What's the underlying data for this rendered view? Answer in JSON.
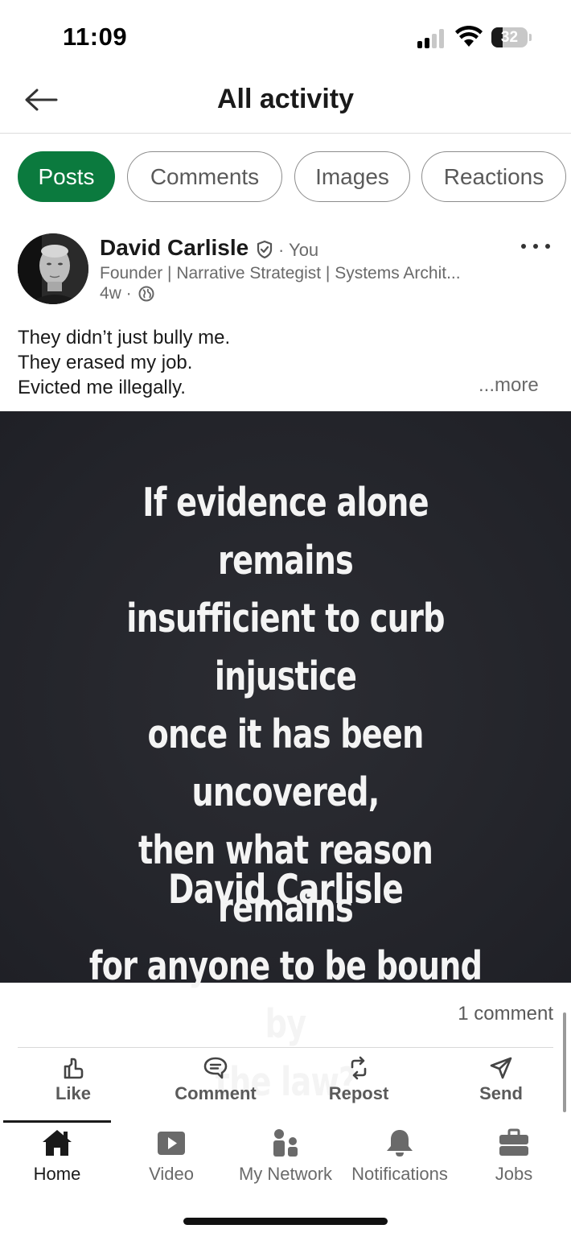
{
  "status_bar": {
    "time": "11:09",
    "battery_level": "32",
    "signal_bars_active": 2,
    "icons": [
      "signal-icon",
      "wifi-icon",
      "battery-icon"
    ]
  },
  "header": {
    "title": "All activity",
    "back_icon": "arrow-left-icon"
  },
  "filters": {
    "chips": [
      {
        "label": "Posts",
        "active": true
      },
      {
        "label": "Comments",
        "active": false
      },
      {
        "label": "Images",
        "active": false
      },
      {
        "label": "Reactions",
        "active": false
      }
    ],
    "active_color": "#0b7a3e"
  },
  "post": {
    "author_name": "David Carlisle",
    "relationship": "· You",
    "headline": "Founder | Narrative Strategist | Systems Archit...",
    "age": "4w ·",
    "visibility_icon": "globe-icon",
    "text_lines": [
      "They didn’t just bully me.",
      "They erased my job.",
      "Evicted me illegally."
    ],
    "see_more": "...more",
    "image": {
      "quote_lines": [
        "If evidence alone remains",
        "insufficient to curb injustice",
        "once it has been uncovered,",
        "then what reason remains",
        "for anyone to be bound by",
        "the law?"
      ],
      "author": "David Carlisle",
      "background": "#24252b"
    },
    "comment_count": "1 comment",
    "actions": [
      {
        "label": "Like",
        "icon": "thumbs-up-icon"
      },
      {
        "label": "Comment",
        "icon": "comment-icon"
      },
      {
        "label": "Repost",
        "icon": "repost-icon"
      },
      {
        "label": "Send",
        "icon": "send-icon"
      }
    ]
  },
  "bottom_nav": {
    "items": [
      {
        "label": "Home",
        "icon": "home-icon",
        "active": true
      },
      {
        "label": "Video",
        "icon": "video-icon",
        "active": false
      },
      {
        "label": "My Network",
        "icon": "network-icon",
        "active": false
      },
      {
        "label": "Notifications",
        "icon": "bell-icon",
        "active": false
      },
      {
        "label": "Jobs",
        "icon": "briefcase-icon",
        "active": false
      }
    ]
  }
}
